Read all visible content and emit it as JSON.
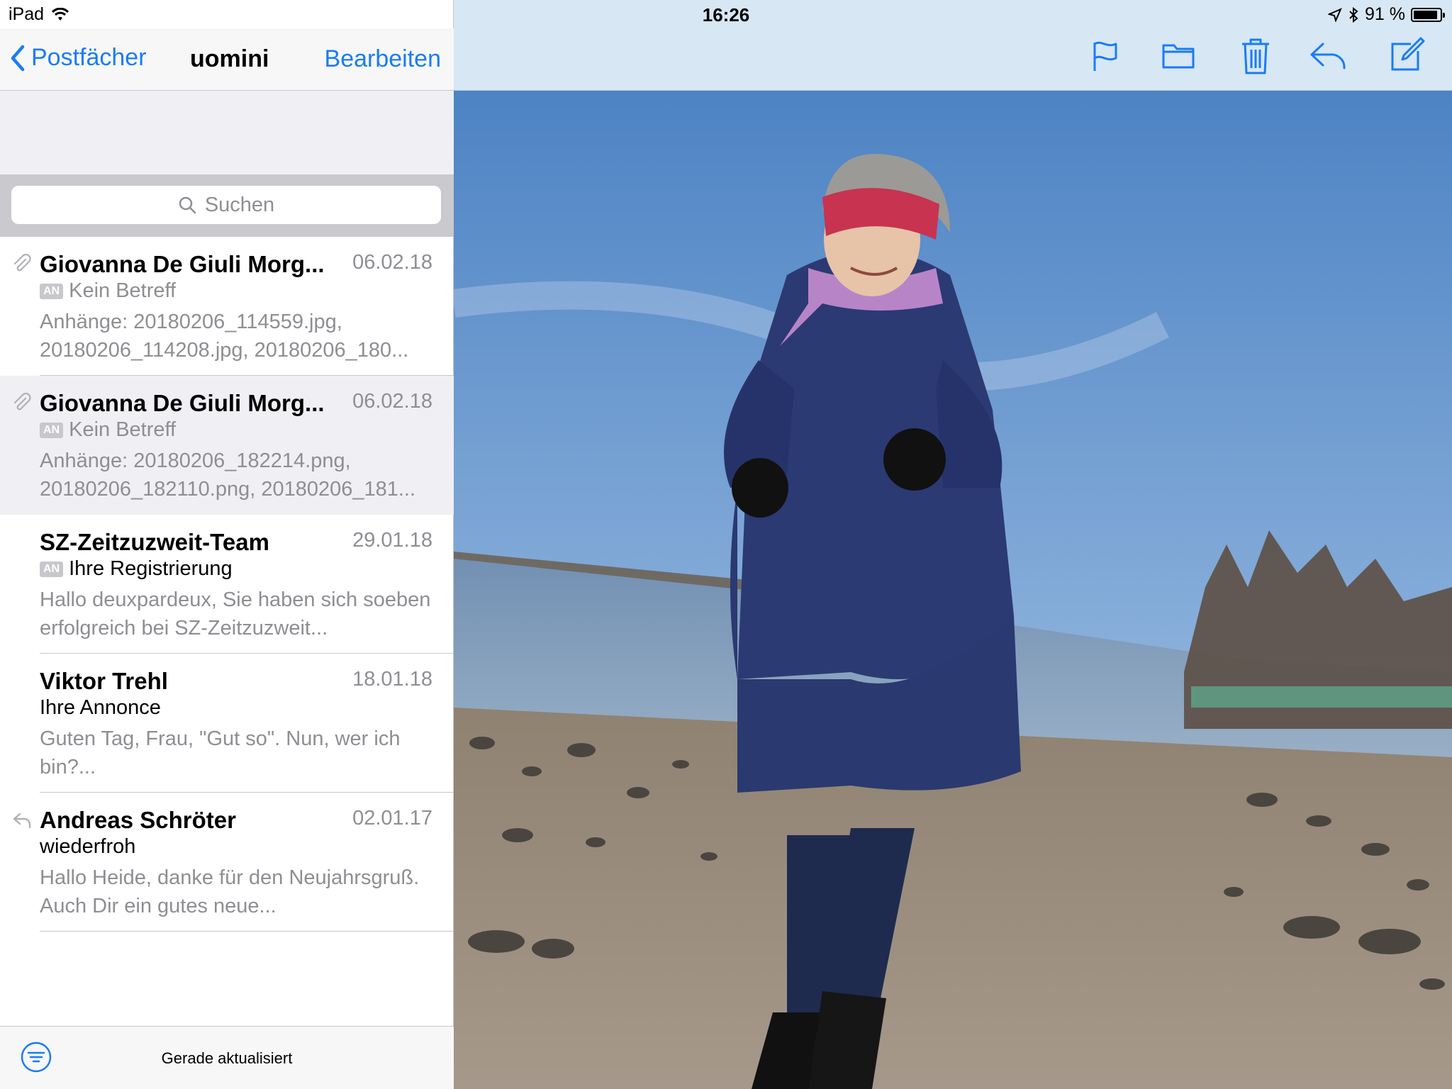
{
  "status_bar": {
    "device": "iPad",
    "time": "16:26",
    "battery": "91 %",
    "battery_level": 0.91
  },
  "mail_nav": {
    "back_label": "Postfächer",
    "title": "uomini",
    "edit_label": "Bearbeiten"
  },
  "search": {
    "placeholder": "Suchen"
  },
  "messages": [
    {
      "sender": "Giovanna De Giuli Morg...",
      "date": "06.02.18",
      "badge": "AN",
      "subject": "Kein Betreff",
      "preview": "Anhänge: 20180206_114559.jpg, 20180206_114208.jpg, 20180206_180...",
      "indicator": "paperclip-icon"
    },
    {
      "sender": "Giovanna De Giuli Morg...",
      "date": "06.02.18",
      "badge": "AN",
      "subject": "Kein Betreff",
      "preview": "Anhänge: 20180206_182214.png, 20180206_182110.png, 20180206_181...",
      "indicator": "paperclip-icon"
    },
    {
      "sender": "SZ-Zeitzuzweit-Team",
      "date": "29.01.18",
      "badge": "AN",
      "subject": "Ihre Registrierung",
      "preview": "Hallo deuxpardeux, Sie haben sich soeben erfolgreich bei SZ-Zeitzuzweit...",
      "indicator": ""
    },
    {
      "sender": "Viktor Trehl",
      "date": "18.01.18",
      "badge": "",
      "subject": "Ihre Annonce",
      "preview": "Guten Tag, Frau, \"Gut so\". Nun, wer ich bin?...",
      "indicator": ""
    },
    {
      "sender": "Andreas Schröter",
      "date": "02.01.17",
      "badge": "",
      "subject": "wiederfroh",
      "preview": "Hallo Heide, danke für den Neujahrsgruß. Auch Dir ein gutes neue...",
      "indicator": "reply-arrow-icon"
    }
  ],
  "bottom_bar": {
    "status": "Gerade aktualisiert"
  },
  "colors": {
    "accent": "#1a7cf4",
    "selected_row": "#efeff4",
    "sky": "#5d8fc9",
    "sand": "#a89886",
    "coat": "#2b3a73"
  }
}
